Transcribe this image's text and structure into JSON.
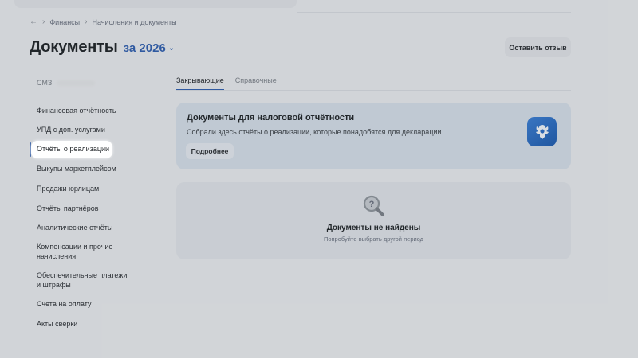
{
  "breadcrumb": {
    "back_icon": "arrow-left-icon",
    "items": [
      "Финансы",
      "Начисления и документы"
    ],
    "separator": "›"
  },
  "header": {
    "title": "Документы",
    "period": "за 2026",
    "period_icon": "chevron-down-icon",
    "feedback_button": "Оставить отзыв"
  },
  "sidebar": {
    "header": "СМЗ",
    "active_index": 2,
    "items": [
      {
        "label": "Финансовая отчётность"
      },
      {
        "label": "УПД с доп. услугами"
      },
      {
        "label": "Отчёты о реализации"
      },
      {
        "label": "Выкупы маркетплейсом"
      },
      {
        "label": "Продажи юрлицам"
      },
      {
        "label": "Отчёты партнёров"
      },
      {
        "label": "Аналитические отчёты"
      },
      {
        "label": "Компенсации и прочие начисления"
      },
      {
        "label": "Обеспечительные платежи и штрафы"
      },
      {
        "label": "Счета на оплату"
      },
      {
        "label": "Акты сверки"
      }
    ]
  },
  "tabs": [
    {
      "label": "Закрывающие",
      "active": true
    },
    {
      "label": "Справочные",
      "active": false
    }
  ],
  "tax_card": {
    "title": "Документы для налоговой отчётности",
    "description": "Собрали здесь отчёты о реализации, которые понадобятся для декларации",
    "button": "Подробнее",
    "icon": "tax-service-emblem-icon"
  },
  "empty_state": {
    "icon": "search-question-icon",
    "title": "Документы не найдены",
    "subtitle": "Попробуйте выбрать другой период"
  },
  "colors": {
    "accent": "#2f5fb0",
    "background": "#ebedf0",
    "tax_card_bg": "#d7e0ea",
    "empty_card_bg": "#e1e5ea"
  }
}
